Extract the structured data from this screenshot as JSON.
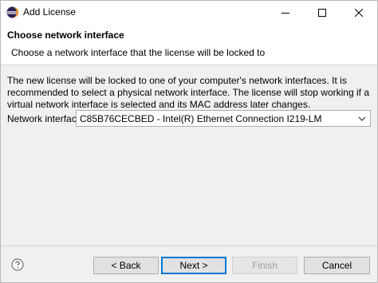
{
  "window": {
    "title": "Add License"
  },
  "header": {
    "title": "Choose network interface",
    "description": "Choose a network interface that the license will be locked to"
  },
  "body": {
    "text": "The new license will be locked to one of your computer's network interfaces. It is recommended to select a physical network interface. The license will stop working if a virtual network interface is selected and its MAC address later changes.",
    "network_interface_label": "Network interface:",
    "network_interface_value": "C85B76CECBED - Intel(R) Ethernet Connection I219-LM"
  },
  "buttons": {
    "back": "< Back",
    "next": "Next >",
    "finish": "Finish",
    "cancel": "Cancel"
  },
  "icons": {
    "app": "eclipse-icon",
    "help": "help-icon",
    "minimize": "minimize-icon",
    "maximize": "maximize-icon",
    "close": "close-icon",
    "dropdown": "chevron-down-icon"
  },
  "colors": {
    "accent": "#0078d7",
    "app_icon": "#2c2255"
  }
}
